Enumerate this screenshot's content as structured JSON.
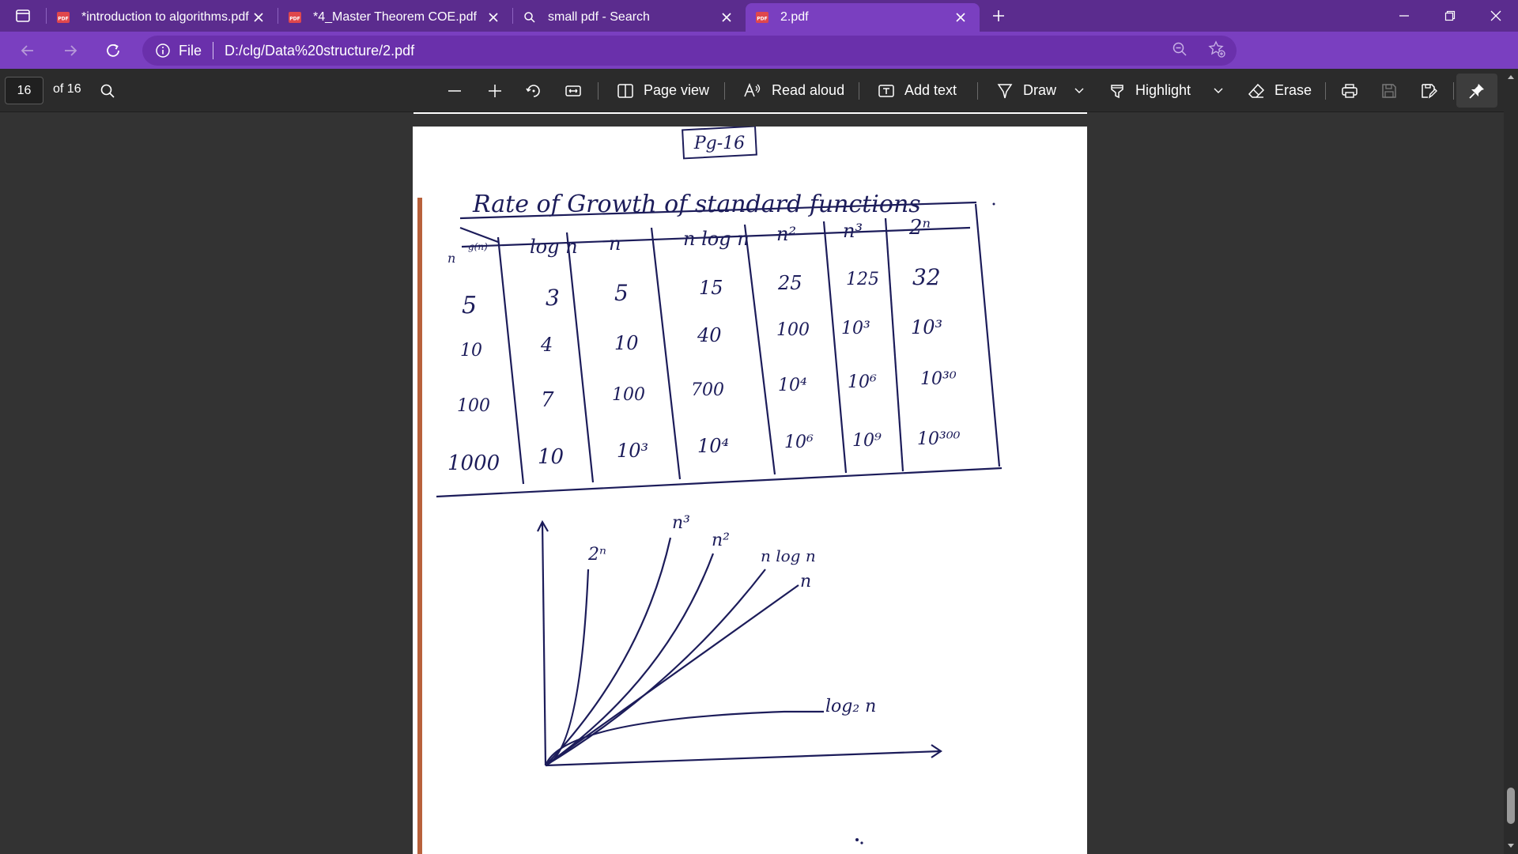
{
  "tabs": [
    {
      "title": "*introduction to algorithms.pdf",
      "icon": "pdf-icon",
      "active": false
    },
    {
      "title": "*4_Master Theorem COE.pdf",
      "icon": "pdf-icon",
      "active": false
    },
    {
      "title": "small pdf - Search",
      "icon": "search-icon",
      "active": false
    },
    {
      "title": "2.pdf",
      "icon": "pdf-icon",
      "active": true
    }
  ],
  "address": {
    "scheme_label": "File",
    "url": "D:/clg/Data%20structure/2.pdf"
  },
  "pdf_toolbar": {
    "page_number": "16",
    "page_count": "of 16",
    "page_view": "Page view",
    "read_aloud": "Read aloud",
    "add_text": "Add text",
    "draw": "Draw",
    "highlight": "Highlight",
    "erase": "Erase"
  },
  "document": {
    "page_tag": "Pg-16",
    "heading": "Rate of Growth of standard functions",
    "table": {
      "corner_n": "n",
      "corner_g": "g(n)",
      "columns": [
        "log n",
        "n",
        "n log n",
        "n²",
        "n³",
        "2ⁿ"
      ],
      "rows": [
        {
          "n": "5",
          "cells": [
            "3",
            "5",
            "15",
            "25",
            "125",
            "32"
          ]
        },
        {
          "n": "10",
          "cells": [
            "4",
            "10",
            "40",
            "100",
            "10³",
            "10³"
          ]
        },
        {
          "n": "100",
          "cells": [
            "7",
            "100",
            "700",
            "10⁴",
            "10⁶",
            "10³⁰"
          ]
        },
        {
          "n": "1000",
          "cells": [
            "10",
            "10³",
            "10⁴",
            "10⁶",
            "10⁹",
            "10³⁰⁰"
          ]
        }
      ]
    },
    "graph_labels": {
      "two_n": "2ⁿ",
      "n_cubed": "n³",
      "n_squared": "n²",
      "n_log_n": "n log n",
      "n": "n",
      "log_n": "log₂ n"
    }
  },
  "colors": {
    "tabbar": "#5b2c8e",
    "addrbar": "#7a3fc0",
    "ink": "#1c1c5a"
  }
}
